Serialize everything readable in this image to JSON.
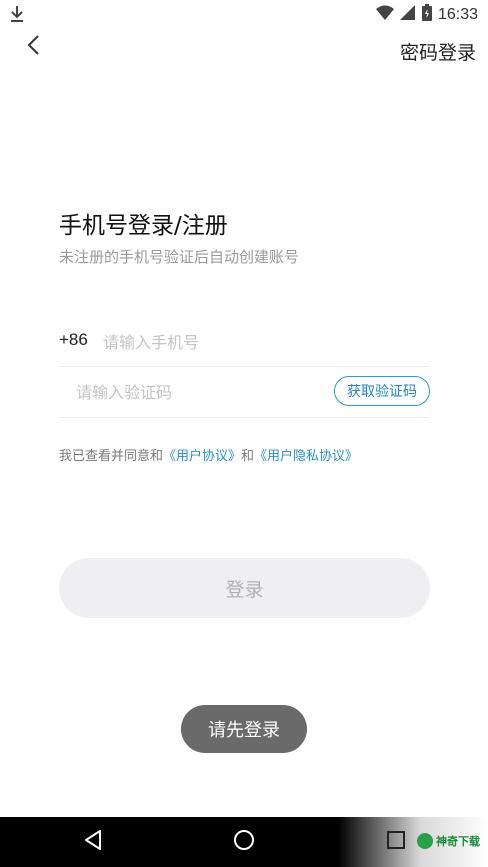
{
  "status_bar": {
    "time": "16:33",
    "icons": [
      "download-icon",
      "wifi-icon",
      "cell-signal-icon",
      "battery-icon"
    ]
  },
  "header": {
    "back_icon": "chevron-left-icon",
    "password_login_label": "密码登录"
  },
  "main": {
    "title": "手机号登录/注册",
    "subtitle": "未注册的手机号验证后自动创建账号"
  },
  "phone": {
    "country_code": "+86",
    "placeholder": "请输入手机号",
    "value": ""
  },
  "code": {
    "placeholder": "请输入验证码",
    "value": "",
    "get_code_label": "获取验证码"
  },
  "agreement": {
    "prefix": "我已查看并同意和",
    "user_agreement": "《用户协议》",
    "conjunction": "和",
    "privacy_agreement": "《用户隐私协议》"
  },
  "login_button": {
    "label": "登录"
  },
  "toast": {
    "message": "请先登录"
  },
  "nav_bar": {
    "icons": [
      "nav-back-icon",
      "nav-home-icon",
      "nav-recent-icon"
    ],
    "watermark_text": "神奇下载"
  },
  "colors": {
    "accent": "#2a9bd3",
    "link": "#2a8fd0",
    "button_disabled_bg": "#efeff1",
    "toast_bg": "#6a6a6a"
  }
}
